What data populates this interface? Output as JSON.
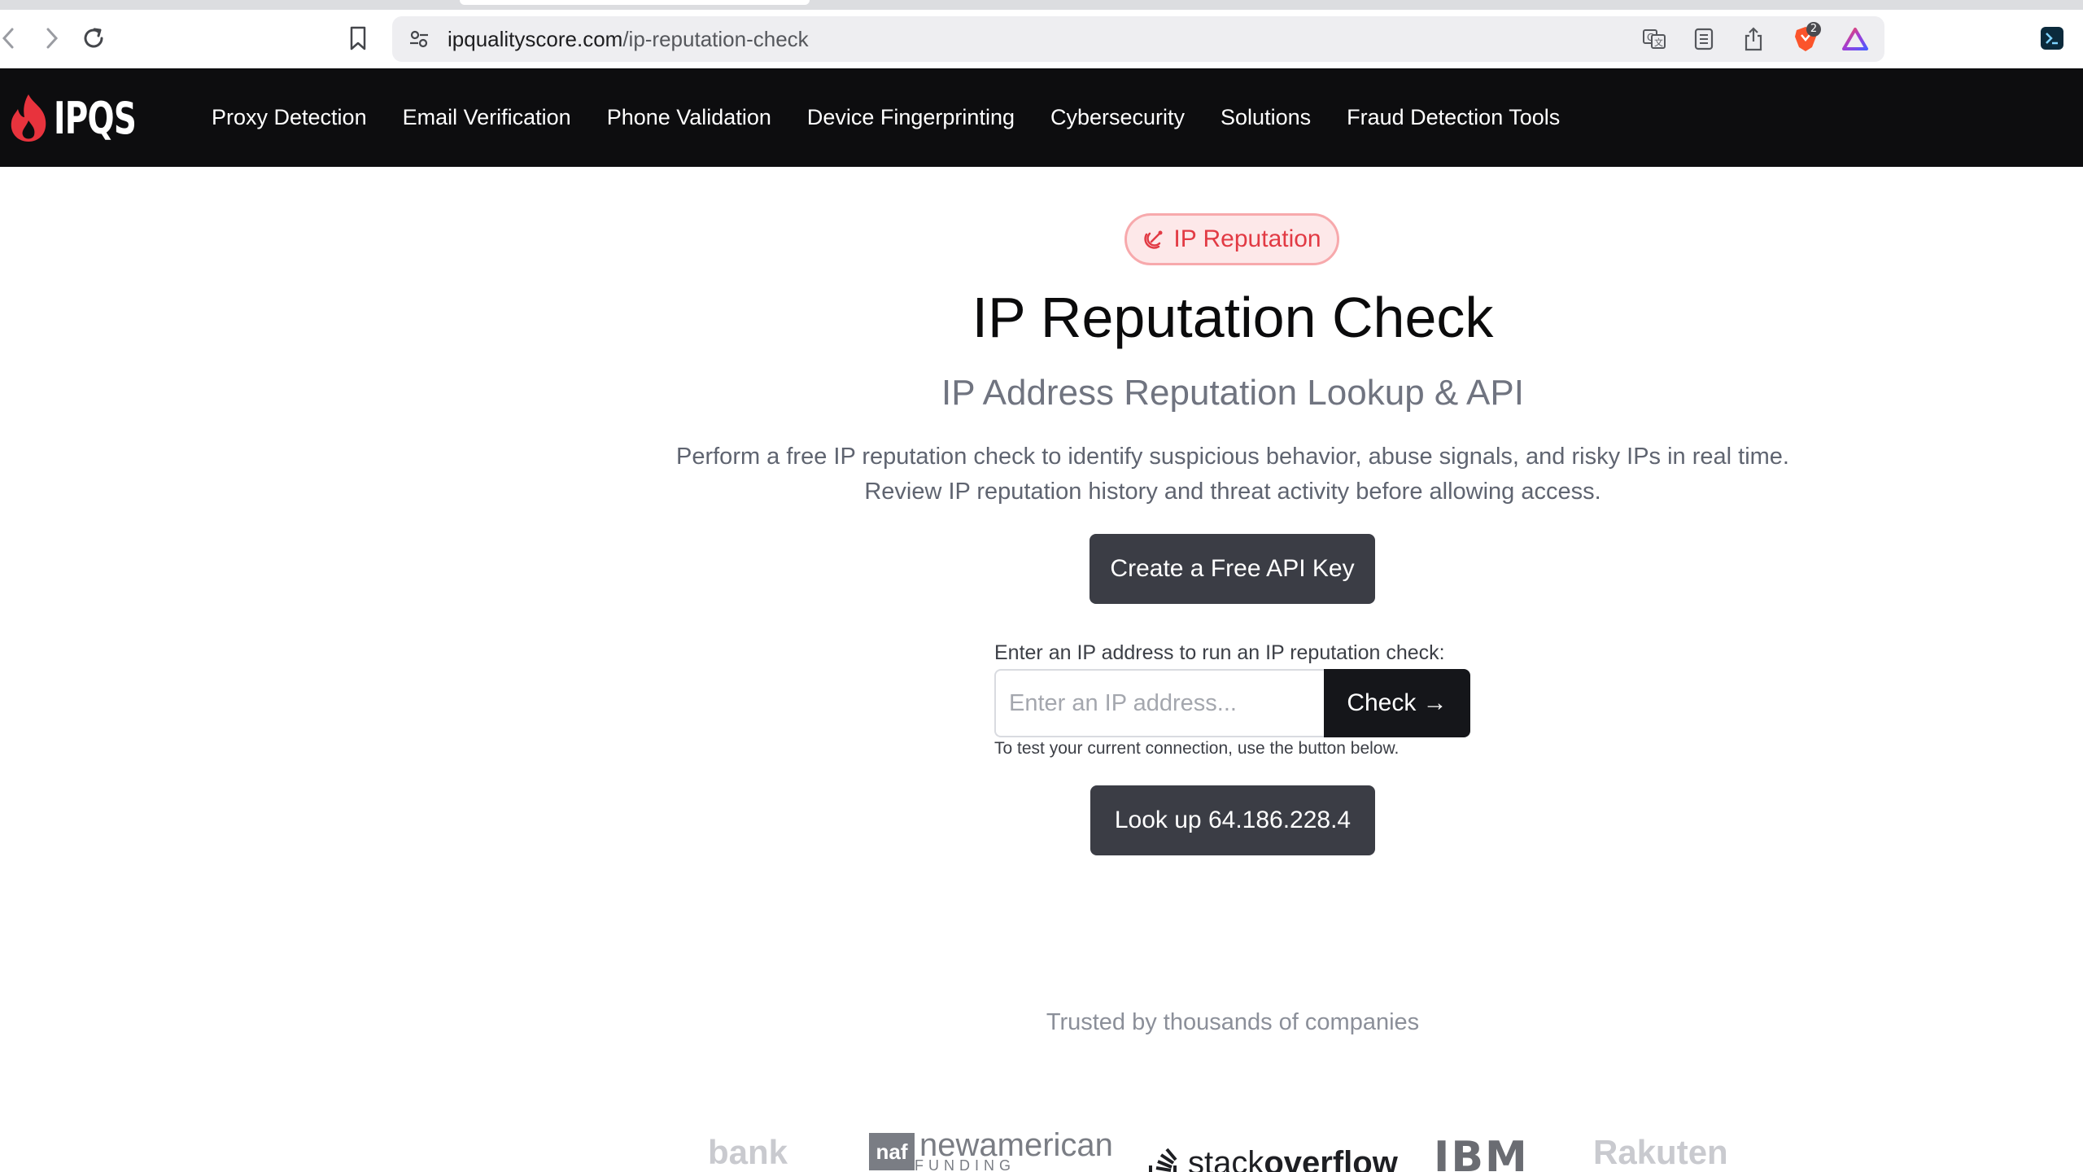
{
  "browser": {
    "url_host": "ipqualityscore.com",
    "url_path": "/ip-reputation-check",
    "shield_badge_count": "2"
  },
  "nav": {
    "logo_text": "IPQS",
    "items": [
      {
        "label": "Proxy Detection"
      },
      {
        "label": "Email Verification"
      },
      {
        "label": "Phone Validation"
      },
      {
        "label": "Device Fingerprinting"
      },
      {
        "label": "Cybersecurity"
      },
      {
        "label": "Solutions"
      },
      {
        "label": "Fraud Detection Tools"
      }
    ]
  },
  "hero": {
    "badge": "IP Reputation",
    "title": "IP Reputation Check",
    "subtitle": "IP Address Reputation Lookup & API",
    "description": "Perform a free IP reputation check to identify suspicious behavior, abuse signals, and risky IPs in real time. Review IP reputation history and threat activity before allowing access.",
    "api_button": "Create a Free API Key"
  },
  "lookup": {
    "label": "Enter an IP address to run an IP reputation check:",
    "input_placeholder": "Enter an IP address...",
    "input_value": "",
    "check_button": "Check →",
    "hint": "To test your current connection, use the button below.",
    "lookup_button": "Look up 64.186.228.4"
  },
  "trusted": {
    "heading": "Trusted by thousands of companies",
    "companies": {
      "bank": "bank",
      "naf_box": "naf",
      "naf_name": "newamerican",
      "naf_sub": "FUNDING",
      "stackoverflow_a": "stack",
      "stackoverflow_b": "overflow",
      "ibm": "IBM",
      "rakuten": "Rakuten"
    }
  },
  "colors": {
    "nav_bg": "#0d0d0f",
    "brand_red": "#e23a44",
    "button_dark": "#3b3d45",
    "check_button": "#15161a"
  }
}
